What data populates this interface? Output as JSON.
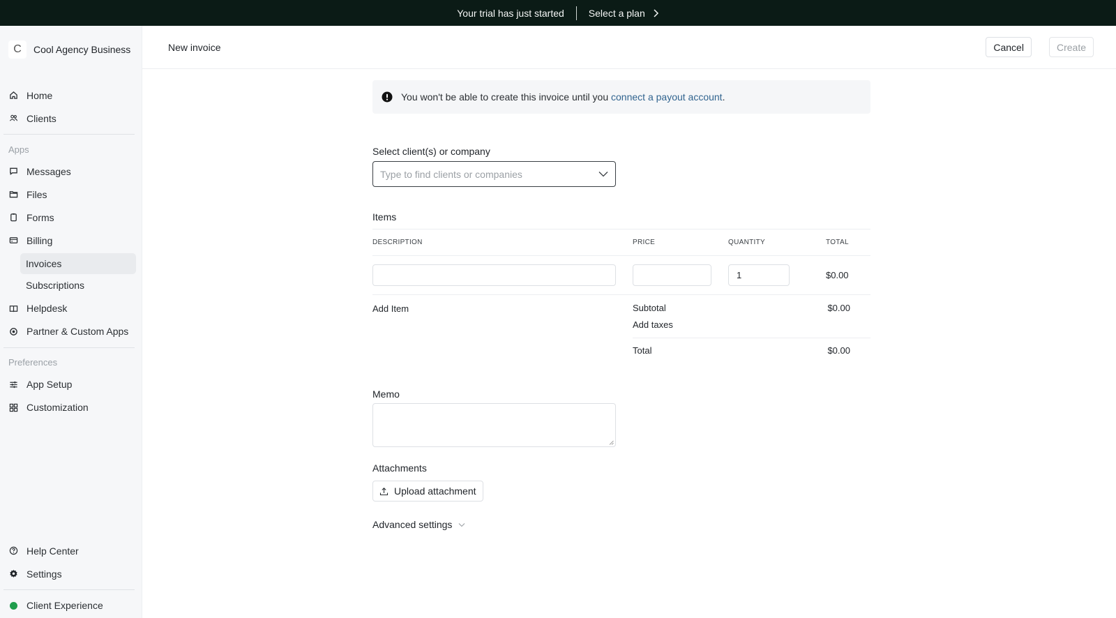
{
  "banner": {
    "message": "Your trial has just started",
    "cta": "Select a plan",
    "background": "#0b1b16"
  },
  "sidebar": {
    "brand": {
      "logo_letter": "C",
      "name": "Cool Agency Business"
    },
    "primary": [
      {
        "label": "Home",
        "icon": "home-icon"
      },
      {
        "label": "Clients",
        "icon": "users-icon"
      }
    ],
    "apps_label": "Apps",
    "apps": [
      {
        "label": "Messages",
        "icon": "message-icon"
      },
      {
        "label": "Files",
        "icon": "folder-icon"
      },
      {
        "label": "Forms",
        "icon": "clipboard-icon"
      },
      {
        "label": "Billing",
        "icon": "credit-card-icon"
      }
    ],
    "billing_sub": [
      {
        "label": "Invoices",
        "active": true
      },
      {
        "label": "Subscriptions",
        "active": false
      }
    ],
    "apps_more": [
      {
        "label": "Helpdesk",
        "icon": "book-icon"
      },
      {
        "label": "Partner & Custom Apps",
        "icon": "apps-icon"
      }
    ],
    "preferences_label": "Preferences",
    "preferences": [
      {
        "label": "App Setup",
        "icon": "sliders-icon"
      },
      {
        "label": "Customization",
        "icon": "grid-icon"
      }
    ],
    "bottom": [
      {
        "label": "Help Center",
        "icon": "help-circle-icon"
      },
      {
        "label": "Settings",
        "icon": "gear-icon"
      }
    ],
    "client_experience": {
      "label": "Client Experience",
      "status_color": "#1f9d4c"
    }
  },
  "header": {
    "title": "New invoice",
    "cancel_label": "Cancel",
    "create_label": "Create"
  },
  "alert": {
    "text": "You won't be able to create this invoice until you ",
    "link": "connect a payout account",
    "suffix": ".",
    "link_color": "#31648f"
  },
  "client_select": {
    "label": "Select client(s) or company",
    "placeholder": "Type to find clients or companies",
    "value": ""
  },
  "items": {
    "title": "Items",
    "columns": [
      "DESCRIPTION",
      "PRICE",
      "QUANTITY",
      "TOTAL"
    ],
    "rows": [
      {
        "description": "",
        "price": "",
        "quantity": "1",
        "total": "$0.00"
      }
    ],
    "add_item_label": "Add Item",
    "subtotal_label": "Subtotal",
    "subtotal_value": "$0.00",
    "add_taxes_label": "Add taxes",
    "total_label": "Total",
    "total_value": "$0.00"
  },
  "memo": {
    "label": "Memo",
    "value": ""
  },
  "attachments": {
    "label": "Attachments",
    "upload_label": "Upload attachment"
  },
  "advanced": {
    "label": "Advanced settings"
  }
}
